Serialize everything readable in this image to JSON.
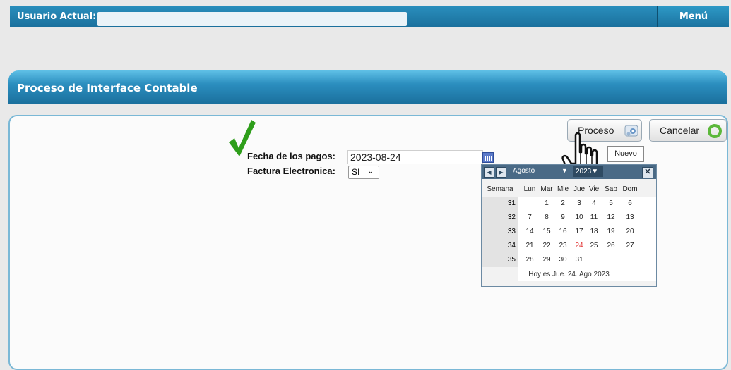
{
  "topbar": {
    "user_label": "Usuario Actual:",
    "menu_label": "Menú"
  },
  "section": {
    "title": "Proceso de Interface Contable"
  },
  "form": {
    "fecha_label": "Fecha de los pagos:",
    "fecha_value": "2023-08-24",
    "factura_label": "Factura Electronica:",
    "factura_value": "SI"
  },
  "buttons": {
    "proceso": "Proceso",
    "cancelar": "Cancelar"
  },
  "tooltip": "Nuevo",
  "calendar": {
    "month": "Agosto",
    "year": "2023",
    "headers": [
      "Semana",
      "Lun",
      "Mar",
      "Mie",
      "Jue",
      "Vie",
      "Sab",
      "Dom"
    ],
    "weeks": [
      {
        "wk": "31",
        "days": [
          "",
          "1",
          "2",
          "3",
          "4",
          "5",
          "6"
        ]
      },
      {
        "wk": "32",
        "days": [
          "7",
          "8",
          "9",
          "10",
          "11",
          "12",
          "13"
        ]
      },
      {
        "wk": "33",
        "days": [
          "14",
          "15",
          "16",
          "17",
          "18",
          "19",
          "20"
        ]
      },
      {
        "wk": "34",
        "days": [
          "21",
          "22",
          "23",
          "24",
          "25",
          "26",
          "27"
        ]
      },
      {
        "wk": "35",
        "days": [
          "28",
          "29",
          "30",
          "31",
          "",
          "",
          ""
        ]
      }
    ],
    "today_label": "Hoy es Jue. 24. Ago 2023",
    "today": "24",
    "today_color": "#e03030"
  },
  "colors": {
    "bar": "#1a6f9c",
    "accent_check": "#2e9e1a"
  }
}
